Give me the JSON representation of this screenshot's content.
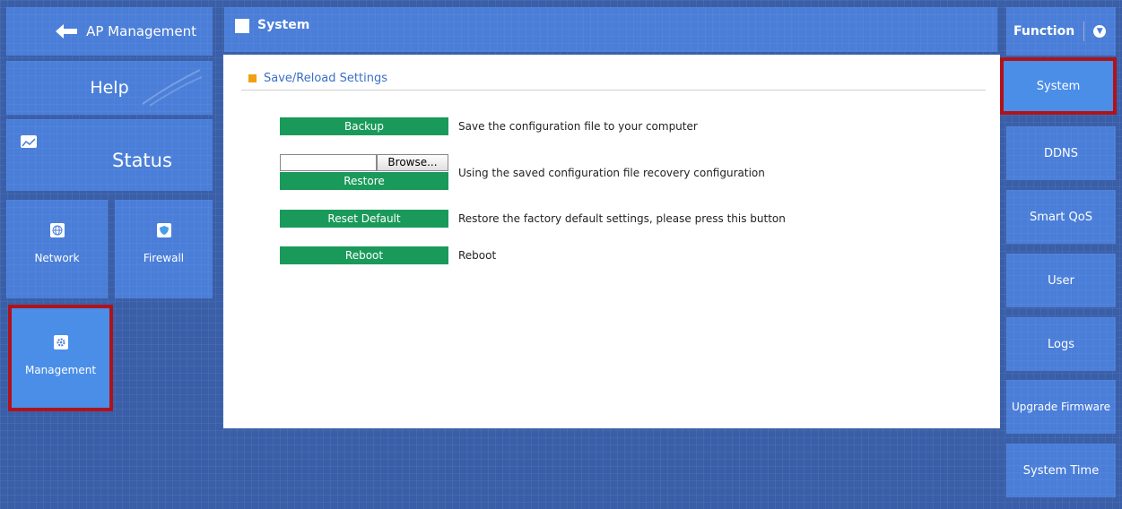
{
  "left_nav": {
    "back": {
      "label": "AP Management"
    },
    "help": {
      "label": "Help"
    },
    "status": {
      "label": "Status"
    },
    "network": {
      "label": "Network"
    },
    "firewall": {
      "label": "Firewall"
    },
    "management": {
      "label": "Management"
    }
  },
  "main": {
    "title": "System",
    "section_title": "Save/Reload Settings",
    "backup": {
      "button": "Backup",
      "description": "Save the configuration file to your computer"
    },
    "restore": {
      "browse": "Browse...",
      "button": "Restore",
      "description": "Using the saved configuration file recovery configuration"
    },
    "reset": {
      "button": "Reset Default",
      "description": "Restore the factory default settings, please press this button"
    },
    "reboot": {
      "button": "Reboot",
      "description": "Reboot"
    }
  },
  "right_nav": {
    "header": "Function",
    "items": [
      "System",
      "DDNS",
      "Smart QoS",
      "User",
      "Logs",
      "Upgrade Firmware",
      "System Time"
    ]
  },
  "colors": {
    "tile": "#4a7ed8",
    "green_button": "#1a9a5a",
    "highlight": "#b0121a",
    "section_bullet": "#f0a010"
  }
}
